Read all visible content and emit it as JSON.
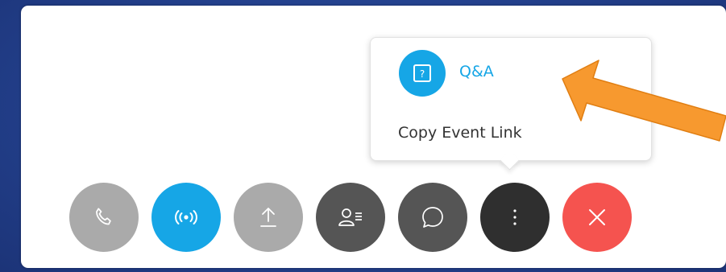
{
  "colors": {
    "accent_blue": "#16a6e6",
    "disabled_gray": "#aaaaaa",
    "dark_gray": "#555555",
    "darker_gray": "#2f2f2f",
    "end_red": "#f5534f",
    "arrow_orange": "#f7992f"
  },
  "menu": {
    "items": [
      {
        "label": "Q&A",
        "icon": "qa-icon"
      },
      {
        "label": "Copy Event Link"
      }
    ]
  },
  "controls": [
    {
      "icon": "phone-icon",
      "state": "disabled"
    },
    {
      "icon": "broadcast-icon",
      "state": "active"
    },
    {
      "icon": "share-upload-icon",
      "state": "disabled"
    },
    {
      "icon": "participants-icon",
      "state": "enabled"
    },
    {
      "icon": "chat-icon",
      "state": "enabled"
    },
    {
      "icon": "more-options-icon",
      "state": "enabled"
    },
    {
      "icon": "close-icon",
      "state": "end"
    }
  ],
  "annotation": {
    "icon": "pointer-arrow"
  }
}
